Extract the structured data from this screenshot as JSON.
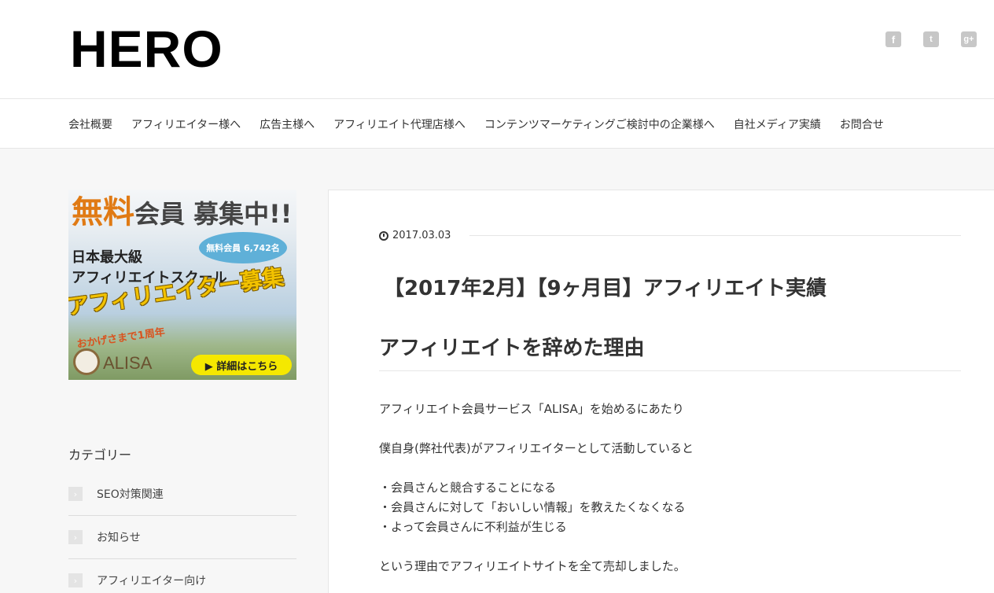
{
  "site": {
    "logo": "HERO"
  },
  "social": [
    {
      "name": "facebook",
      "glyph": "f"
    },
    {
      "name": "twitter",
      "glyph": "t"
    },
    {
      "name": "google-plus",
      "glyph": "g+"
    }
  ],
  "nav": {
    "items": [
      {
        "label": "会社概要"
      },
      {
        "label": "アフィリエイター様へ"
      },
      {
        "label": "広告主様へ"
      },
      {
        "label": "アフィリエイト代理店様へ"
      },
      {
        "label": "コンテンツマーケティングご検討中の企業様へ"
      },
      {
        "label": "自社メディア実績"
      },
      {
        "label": "お問合せ"
      }
    ]
  },
  "banner": {
    "top_orange": "無料",
    "top_dark": "会員 募集中!!",
    "badge": "無料会員 6,742名",
    "line1": "日本最大級",
    "line2": "アフィリエイトスクール",
    "main": "アフィリエイター募集",
    "anniversary": "おかげさまで1周年",
    "logo": "ALISA",
    "button": "▶ 詳細はこちら"
  },
  "sidebar": {
    "category_title": "カテゴリー",
    "categories": [
      {
        "label": "SEO対策関連"
      },
      {
        "label": "お知らせ"
      },
      {
        "label": "アフィリエイター向け"
      }
    ]
  },
  "post": {
    "date": "2017.03.03",
    "title": "【2017年2月】【9ヶ月目】アフィリエイト実績",
    "heading": "アフィリエイトを辞めた理由",
    "paragraphs": [
      "アフィリエイト会員サービス「ALISA」を始めるにあたり",
      "僕自身(弊社代表)がアフィリエイターとして活動していると",
      "・会員さんと競合することになる",
      "・会員さんに対して「おいしい情報」を教えたくなくなる",
      "・よって会員さんに不利益が生じる",
      "という理由でアフィリエイトサイトを全て売却しました。"
    ]
  }
}
